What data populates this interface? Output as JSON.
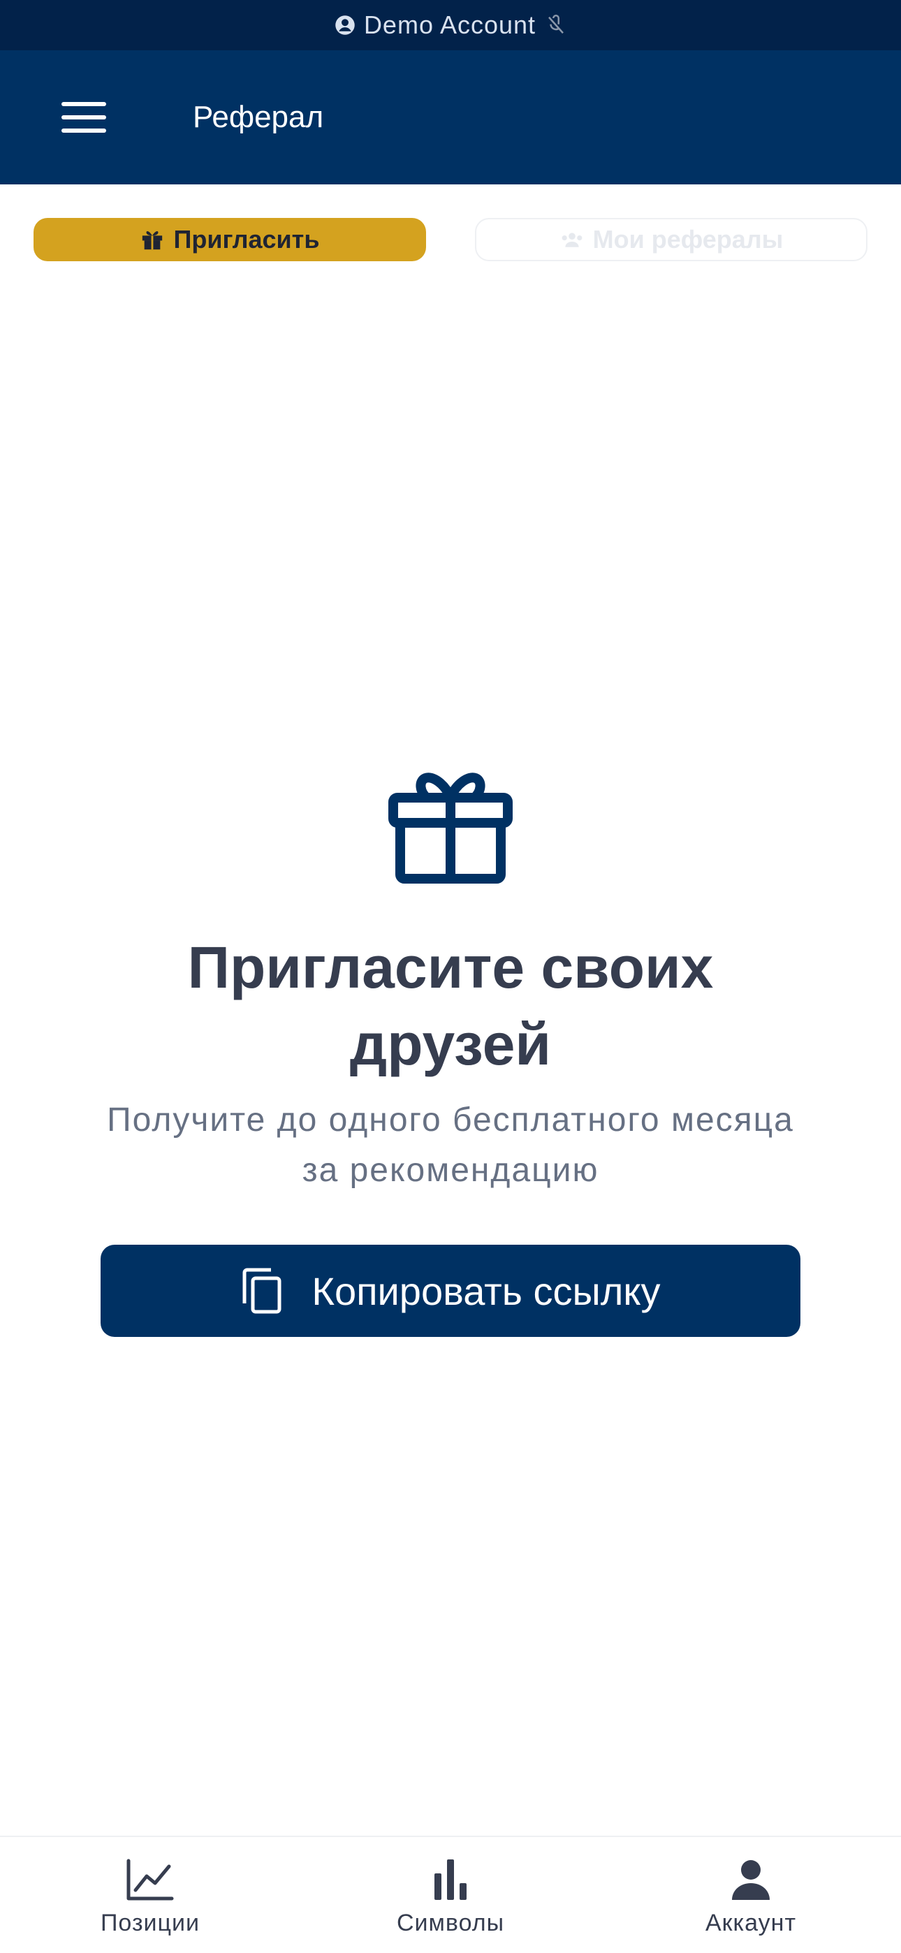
{
  "status_bar": {
    "account_label": "Demo Account"
  },
  "header": {
    "title": "Реферал",
    "menu_icon": "hamburger-menu-icon"
  },
  "tabs": [
    {
      "label": "Пригласить",
      "icon": "gift-icon",
      "active": true
    },
    {
      "label": "Мои рефералы",
      "icon": "users-icon",
      "active": false
    }
  ],
  "hero": {
    "icon": "gift-icon",
    "title": "Пригласите своих друзей",
    "subtitle": "Получите до одного бесплатного месяца за рекомендацию"
  },
  "copy_button": {
    "label": "Копировать ссылку",
    "icon": "copy-icon"
  },
  "bottom_nav": [
    {
      "label": "Позиции",
      "icon": "line-chart-icon"
    },
    {
      "label": "Символы",
      "icon": "bar-chart-icon"
    },
    {
      "label": "Аккаунт",
      "icon": "user-icon"
    }
  ],
  "colors": {
    "status_bar_bg": "#02224a",
    "app_bar_bg": "#003163",
    "accent_gold": "#d4a21f",
    "primary_navy": "#003163",
    "text_dark": "#363d4f",
    "text_muted": "#667083"
  }
}
